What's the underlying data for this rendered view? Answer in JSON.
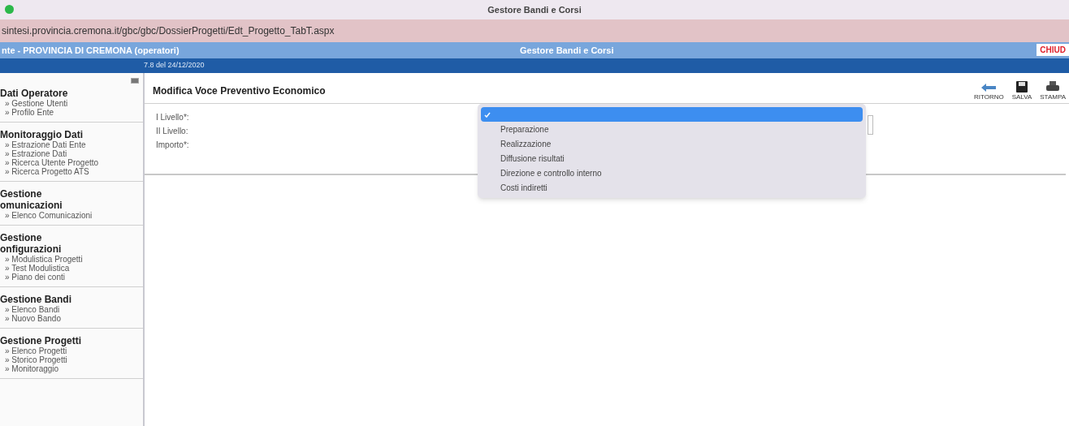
{
  "window": {
    "title": "Gestore Bandi e Corsi"
  },
  "address_bar": {
    "url": "sintesi.provincia.cremona.it/gbc/gbc/DossierProgetti/Edt_Progetto_TabT.aspx"
  },
  "header": {
    "left": "nte - PROVINCIA DI CREMONA (operatori)",
    "center": "Gestore Bandi e Corsi",
    "right": "CHIUD",
    "version": "7.8 del 24/12/2020"
  },
  "sidebar": {
    "sections": [
      {
        "title_lines": [
          "Dati Operatore"
        ],
        "items": [
          "» Gestione Utenti",
          "» Profilo Ente"
        ]
      },
      {
        "title_lines": [
          "Monitoraggio Dati"
        ],
        "items": [
          "» Estrazione Dati Ente",
          "» Estrazione Dati",
          "» Ricerca Utente Progetto",
          "» Ricerca Progetto ATS"
        ]
      },
      {
        "title_lines": [
          "Gestione",
          "omunicazioni"
        ],
        "items": [
          "» Elenco Comunicazioni"
        ]
      },
      {
        "title_lines": [
          "Gestione",
          "onfigurazioni"
        ],
        "items": [
          "» Modulistica Progetti",
          "» Test Modulistica",
          "» Piano dei conti"
        ]
      },
      {
        "title_lines": [
          "Gestione Bandi"
        ],
        "items": [
          "» Elenco Bandi",
          "» Nuovo Bando"
        ]
      },
      {
        "title_lines": [
          "Gestione Progetti"
        ],
        "items": [
          "» Elenco Progetti",
          "» Storico Progetti",
          "» Monitoraggio"
        ]
      }
    ]
  },
  "form": {
    "title": "Modifica Voce Preventivo Economico",
    "toolbar": [
      {
        "kind": "back",
        "label": "RITORNO"
      },
      {
        "kind": "save",
        "label": "SALVA"
      },
      {
        "kind": "print",
        "label": "STAMPA"
      }
    ],
    "fields": [
      {
        "label": "I Livello*:"
      },
      {
        "label": "II Livello:"
      },
      {
        "label": "Importo*:"
      }
    ]
  },
  "dropdown": {
    "options": [
      {
        "selected": true
      },
      {
        "label": "Preparazione",
        "selected": false
      },
      {
        "label": "Realizzazione",
        "selected": false
      },
      {
        "label": "Diffusione risultati",
        "selected": false
      },
      {
        "label": "Direzione e controllo interno",
        "selected": false
      },
      {
        "label": "Costi indiretti",
        "selected": false
      }
    ]
  }
}
